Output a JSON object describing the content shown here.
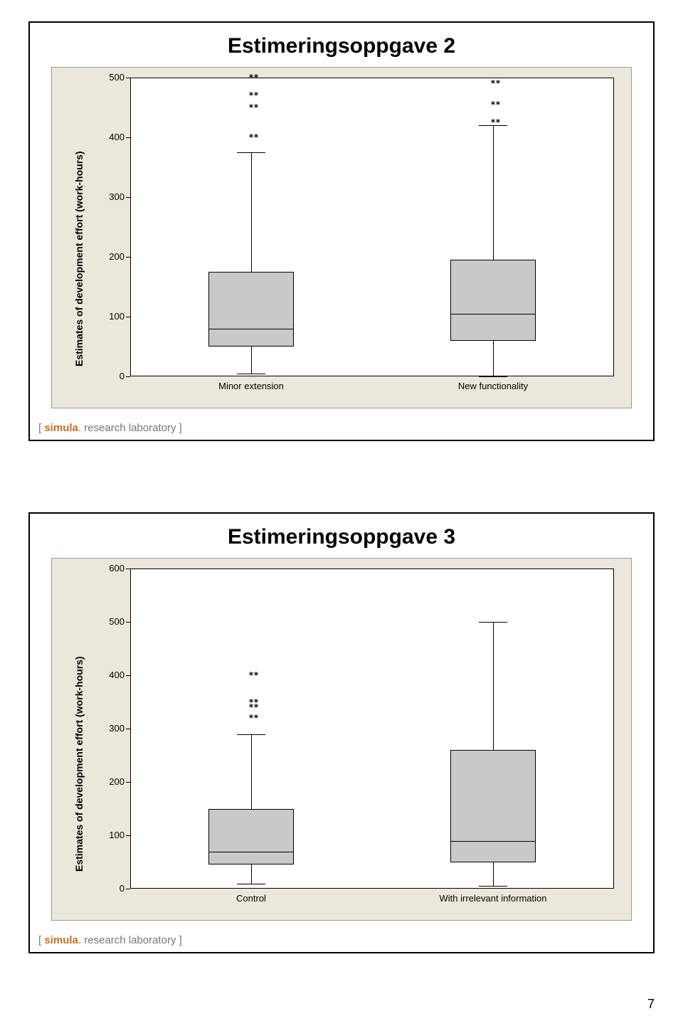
{
  "page_number": "7",
  "brand_a": "simula",
  "brand_b": ". research laboratory ]",
  "brand_open": "[ ",
  "slide1": {
    "title": "Estimeringsoppgave 2",
    "ylabel": "Estimates of development effort (work-hours)",
    "ticks": [
      "0",
      "100",
      "200",
      "300",
      "400",
      "500"
    ],
    "cat1": "Minor extension",
    "cat2": "New functionality"
  },
  "slide2": {
    "title": "Estimeringsoppgave 3",
    "ylabel": "Estimates of development effort (work-hours)",
    "ticks": [
      "0",
      "100",
      "200",
      "300",
      "400",
      "500",
      "600"
    ],
    "cat1": "Control",
    "cat2": "With irrelevant information"
  },
  "chart_data": [
    {
      "type": "boxplot",
      "title": "Estimeringsoppgave 2",
      "ylabel": "Estimates of development effort (work-hours)",
      "ylim": [
        0,
        500
      ],
      "categories": [
        "Minor extension",
        "New functionality"
      ],
      "series": [
        {
          "name": "Minor extension",
          "whisker_low": 5,
          "q1": 50,
          "median": 80,
          "q3": 175,
          "whisker_high": 375,
          "outliers": [
            400,
            450,
            470,
            500
          ]
        },
        {
          "name": "New functionality",
          "whisker_low": 0,
          "q1": 60,
          "median": 105,
          "q3": 195,
          "whisker_high": 420,
          "outliers": [
            425,
            455,
            490
          ]
        }
      ]
    },
    {
      "type": "boxplot",
      "title": "Estimeringsoppgave 3",
      "ylabel": "Estimates of development effort (work-hours)",
      "ylim": [
        0,
        600
      ],
      "categories": [
        "Control",
        "With irrelevant information"
      ],
      "series": [
        {
          "name": "Control",
          "whisker_low": 10,
          "q1": 45,
          "median": 70,
          "q3": 150,
          "whisker_high": 290,
          "outliers": [
            320,
            340,
            350,
            400
          ]
        },
        {
          "name": "With irrelevant information",
          "whisker_low": 5,
          "q1": 50,
          "median": 90,
          "q3": 260,
          "whisker_high": 500,
          "outliers": []
        }
      ]
    }
  ]
}
